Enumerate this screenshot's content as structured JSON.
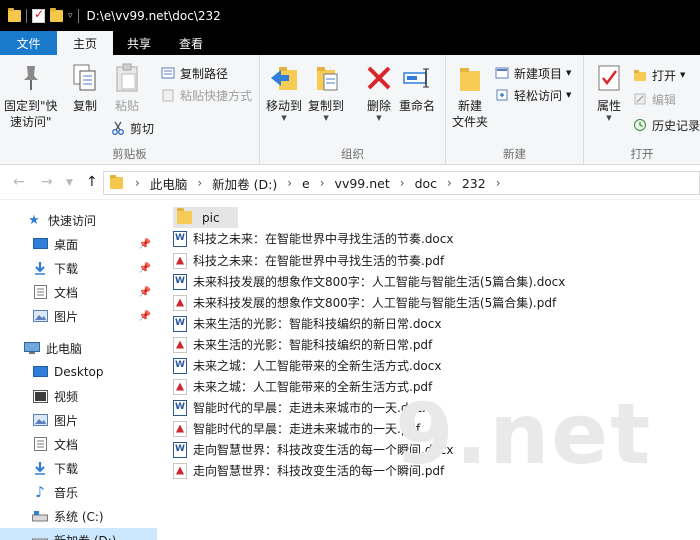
{
  "window": {
    "title_path": "D:\\e\\vv99.net\\doc\\232"
  },
  "tabs": [
    "文件",
    "主页",
    "共享",
    "查看"
  ],
  "ribbon": {
    "clipboard": {
      "label": "剪贴板",
      "pin": "固定到\"快",
      "pin2": "速访问\"",
      "copy": "复制",
      "paste": "粘贴",
      "copy_path": "复制路径",
      "paste_shortcut": "粘贴快捷方式",
      "cut": "剪切"
    },
    "organize": {
      "label": "组织",
      "move_to": "移动到",
      "copy_to": "复制到",
      "delete": "删除",
      "rename": "重命名"
    },
    "new": {
      "label": "新建",
      "new_folder": "新建",
      "new_folder2": "文件夹",
      "new_item": "新建项目",
      "easy_access": "轻松访问"
    },
    "open": {
      "label": "打开",
      "properties": "属性",
      "open": "打开",
      "edit": "编辑",
      "history": "历史记录"
    }
  },
  "address": {
    "crumbs": [
      "此电脑",
      "新加卷 (D:)",
      "e",
      "vv99.net",
      "doc",
      "232"
    ]
  },
  "nav": {
    "quick_access": "快速访问",
    "quick_items": [
      "桌面",
      "下载",
      "文档",
      "图片"
    ],
    "this_pc": "此电脑",
    "pc_items": [
      "Desktop",
      "视频",
      "图片",
      "文档",
      "下载",
      "音乐",
      "系统 (C:)",
      "新加卷 (D:)"
    ]
  },
  "files": [
    {
      "name": "pic",
      "type": "folder"
    },
    {
      "name": "科技之未来：在智能世界中寻找生活的节奏.docx",
      "type": "docx"
    },
    {
      "name": "科技之未来：在智能世界中寻找生活的节奏.pdf",
      "type": "pdf"
    },
    {
      "name": "未来科技发展的想象作文800字：人工智能与智能生活(5篇合集).docx",
      "type": "docx"
    },
    {
      "name": "未来科技发展的想象作文800字：人工智能与智能生活(5篇合集).pdf",
      "type": "pdf"
    },
    {
      "name": "未来生活的光影：智能科技编织的新日常.docx",
      "type": "docx"
    },
    {
      "name": "未来生活的光影：智能科技编织的新日常.pdf",
      "type": "pdf"
    },
    {
      "name": "未来之城：人工智能带来的全新生活方式.docx",
      "type": "docx"
    },
    {
      "name": "未来之城：人工智能带来的全新生活方式.pdf",
      "type": "pdf"
    },
    {
      "name": "智能时代的早晨：走进未来城市的一天.docx",
      "type": "docx"
    },
    {
      "name": "智能时代的早晨：走进未来城市的一天.pdf",
      "type": "pdf"
    },
    {
      "name": "走向智慧世界：科技改变生活的每一个瞬间.docx",
      "type": "docx"
    },
    {
      "name": "走向智慧世界：科技改变生活的每一个瞬间.pdf",
      "type": "pdf"
    }
  ],
  "watermark": "9.net",
  "colors": {
    "file_tab": "#1979ca",
    "selection": "#cce8ff",
    "folder": "#f6cc56"
  }
}
